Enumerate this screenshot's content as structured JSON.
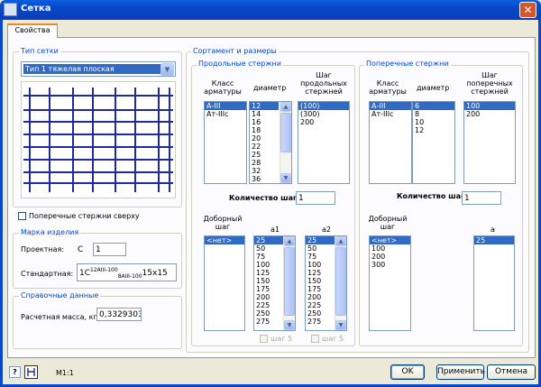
{
  "window": {
    "title": "Сетка",
    "close_label": "✕"
  },
  "tab": {
    "label": "Свойства"
  },
  "mesh_type": {
    "title": "Тип сетки",
    "selected": "Тип 1 тяжелая плоская",
    "transverse_on_top": "Поперечные стержни сверху"
  },
  "marking": {
    "title": "Марка изделия",
    "design_label": "Проектная:",
    "design_prefix": "С",
    "design_value": "1",
    "standard_label": "Стандартная:",
    "std_a": "1С",
    "std_sup": "12AIII-100",
    "std_sub": "8AIII-100",
    "std_b": "15x15"
  },
  "reference": {
    "title": "Справочные данные",
    "mass_label": "Расчетная масса, кг:",
    "mass_value": "0,3329303"
  },
  "assortment": {
    "title": "Сортамент и размеры",
    "longitudinal": {
      "title": "Продольные стержни",
      "class_header": "Класс арматуры",
      "diam_header": "диаметр",
      "step_header": "Шаг продольных стержней",
      "classes": [
        "А-III",
        "Ат-IIIс"
      ],
      "diameters": [
        "12",
        "14",
        "16",
        "18",
        "20",
        "22",
        "25",
        "28",
        "32",
        "36"
      ],
      "steps": [
        "(100)",
        "(300)",
        "200"
      ],
      "steps_count_label": "Количество шагов:",
      "steps_count": "1",
      "extra_step_header": "Доборный шаг",
      "extra_steps": [
        "<нет>"
      ],
      "a1_header": "а1",
      "a1": [
        "25",
        "50",
        "75",
        "100",
        "125",
        "150",
        "175",
        "200",
        "225",
        "250",
        "275"
      ],
      "a2_header": "а2",
      "a2": [
        "25",
        "50",
        "75",
        "100",
        "125",
        "150",
        "175",
        "200",
        "225",
        "250",
        "275"
      ],
      "step5_label": "шаг 5"
    },
    "transverse": {
      "title": "Поперечные стержни",
      "class_header": "Класс арматуры",
      "diam_header": "диаметр",
      "step_header": "Шаг поперечных стержней",
      "classes": [
        "А-III",
        "Ат-IIIс"
      ],
      "diameters": [
        "6",
        "8",
        "10",
        "12"
      ],
      "steps": [
        "100",
        "200"
      ],
      "steps_count_label": "Количество шагов:",
      "steps_count": "1",
      "extra_step_header": "Доборный шаг",
      "extra_steps": [
        "<нет>",
        "100",
        "200",
        "300"
      ],
      "a_header": "а",
      "a": [
        "25"
      ]
    }
  },
  "footer": {
    "help_icon_label": "?",
    "scale": "М1:1",
    "ok": "OK",
    "apply": "Применить",
    "cancel": "Отмена"
  },
  "colors": {
    "accent": "#0046d5",
    "selection": "#316ac5",
    "mesh": "#1f2a9c"
  }
}
